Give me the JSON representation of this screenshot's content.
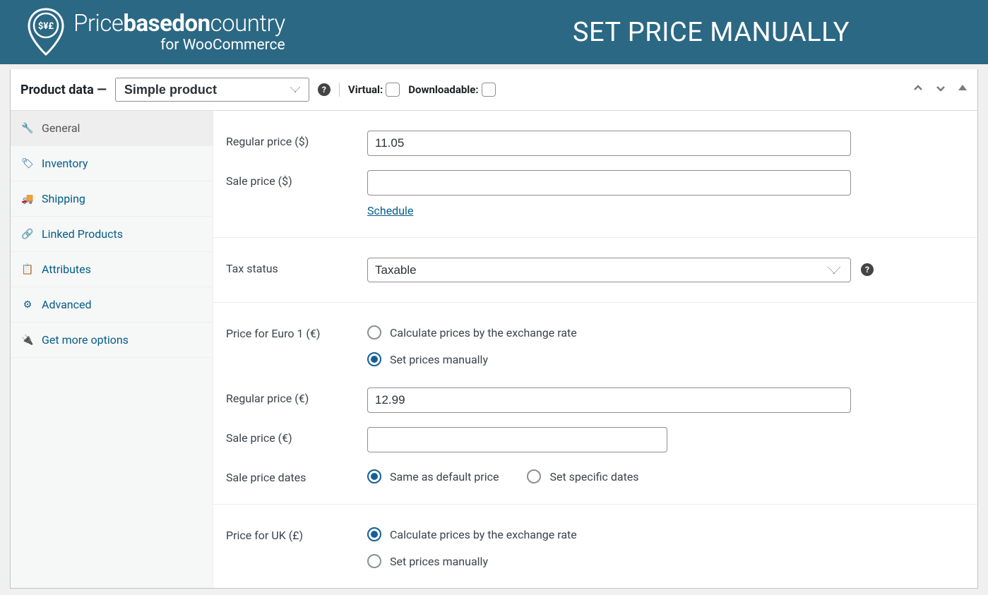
{
  "banner": {
    "logo_title_1": "Price",
    "logo_title_2": "basedon",
    "logo_title_3": "country",
    "logo_sub": "for WooCommerce",
    "title": "SET PRICE MANUALLY"
  },
  "panel": {
    "title": "Product data —",
    "product_type": "Simple product",
    "virtual_label": "Virtual:",
    "downloadable_label": "Downloadable:"
  },
  "sidebar": {
    "items": [
      {
        "label": "General"
      },
      {
        "label": "Inventory"
      },
      {
        "label": "Shipping"
      },
      {
        "label": "Linked Products"
      },
      {
        "label": "Attributes"
      },
      {
        "label": "Advanced"
      },
      {
        "label": "Get more options"
      }
    ]
  },
  "fields": {
    "regular_price_label": "Regular price ($)",
    "regular_price_value": "11.05",
    "sale_price_label": "Sale price ($)",
    "sale_price_value": "",
    "schedule_label": "Schedule",
    "tax_status_label": "Tax status",
    "tax_status_value": "Taxable",
    "euro_label": "Price for Euro 1 (€)",
    "opt_calc": "Calculate prices by the exchange rate",
    "opt_manual": "Set prices manually",
    "regular_price_eur_label": "Regular price (€)",
    "regular_price_eur_value": "12.99",
    "sale_price_eur_label": "Sale price (€)",
    "sale_price_eur_value": "",
    "sale_dates_label": "Sale price dates",
    "opt_same": "Same as default price",
    "opt_specific": "Set specific dates",
    "uk_label": "Price for UK (£)"
  }
}
